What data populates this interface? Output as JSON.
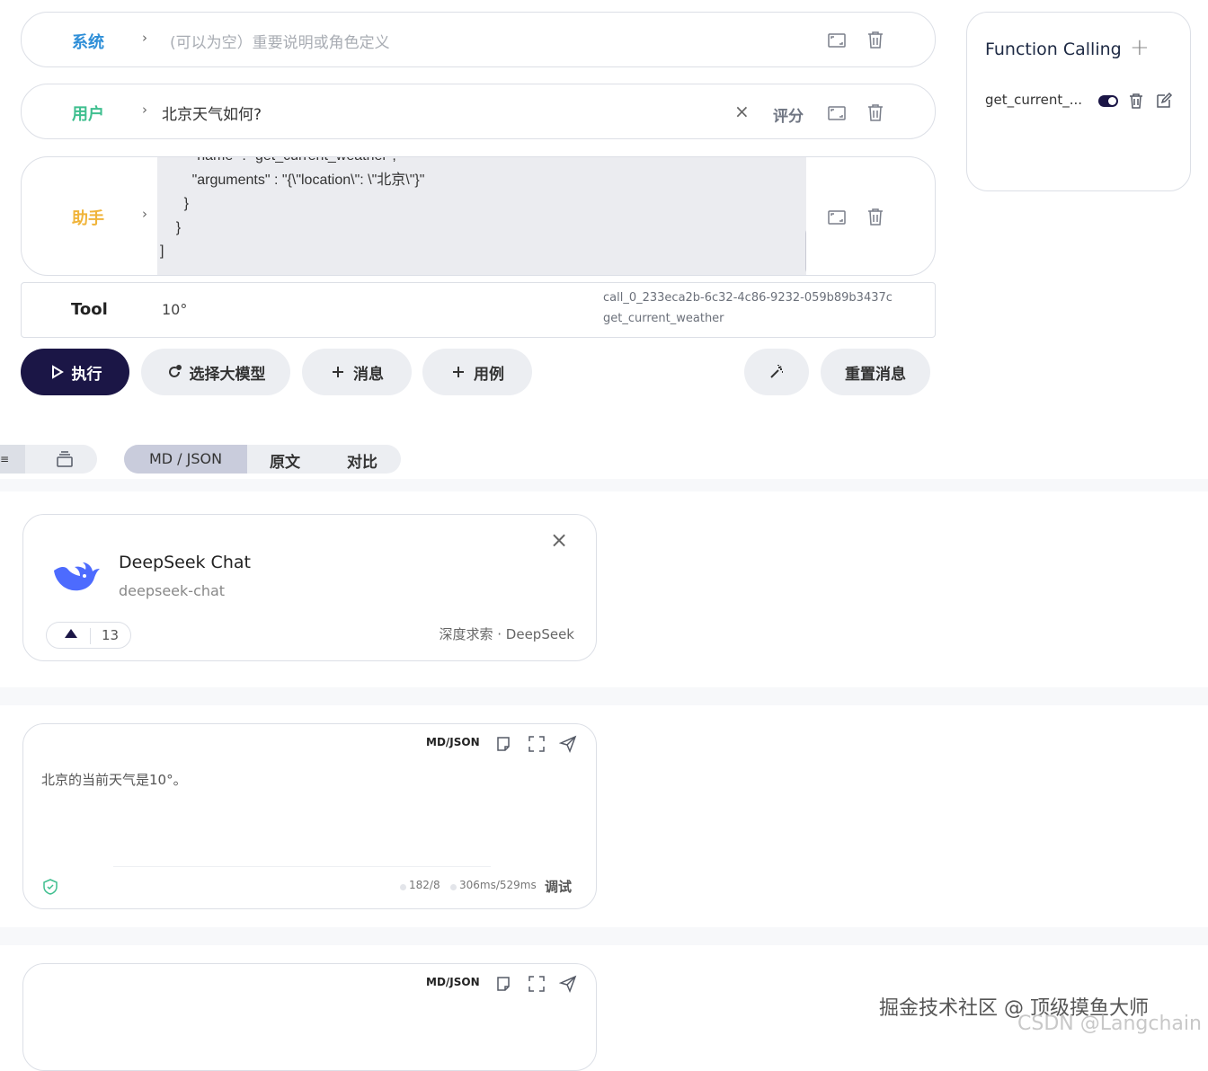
{
  "messages": {
    "system": {
      "role": "系统",
      "placeholder": "(可以为空）重要说明或角色定义",
      "color": "#2f8fd8"
    },
    "user": {
      "role": "用户",
      "text": "北京天气如何?",
      "rate_label": "评分",
      "color": "#3fbf8f"
    },
    "assistant": {
      "role": "助手",
      "color": "#f0b43a",
      "code_lines": [
        "        \"name\" : \"get_current_weather\",",
        "        \"arguments\" : \"{\\\"location\\\": \\\"北京\\\"}\"",
        "      }",
        "    }",
        "]"
      ]
    },
    "tool": {
      "role": "Tool",
      "value": "10°",
      "call_id": "call_0_233eca2b-6c32-4c86-9232-059b89b3437c",
      "function_name": "get_current_weather"
    }
  },
  "toolbar": {
    "run": "执行",
    "select_model": "选择大模型",
    "add_message": "消息",
    "add_example": "用例",
    "reset": "重置消息"
  },
  "function_panel": {
    "title": "Function Calling",
    "items": [
      {
        "name": "get_current_..."
      }
    ]
  },
  "view_tabs": [
    "MD / JSON",
    "原文",
    "对比"
  ],
  "model_card": {
    "name": "DeepSeek Chat",
    "id": "deepseek-chat",
    "votes": "13",
    "provider": "深度求索 · DeepSeek"
  },
  "response_card": {
    "format_label": "MD/JSON",
    "text": "北京的当前天气是10°。",
    "tokens": "182/8",
    "timing": "306ms/529ms",
    "debug": "调试"
  },
  "response_card_2": {
    "format_label": "MD/JSON"
  },
  "watermark": {
    "line1": "掘金技术社区 @ 顶级摸鱼大师",
    "line2": "CSDN @Langchain"
  },
  "colors": {
    "primary_dark": "#1b1646",
    "accent_blue": "#4d6bfe"
  }
}
